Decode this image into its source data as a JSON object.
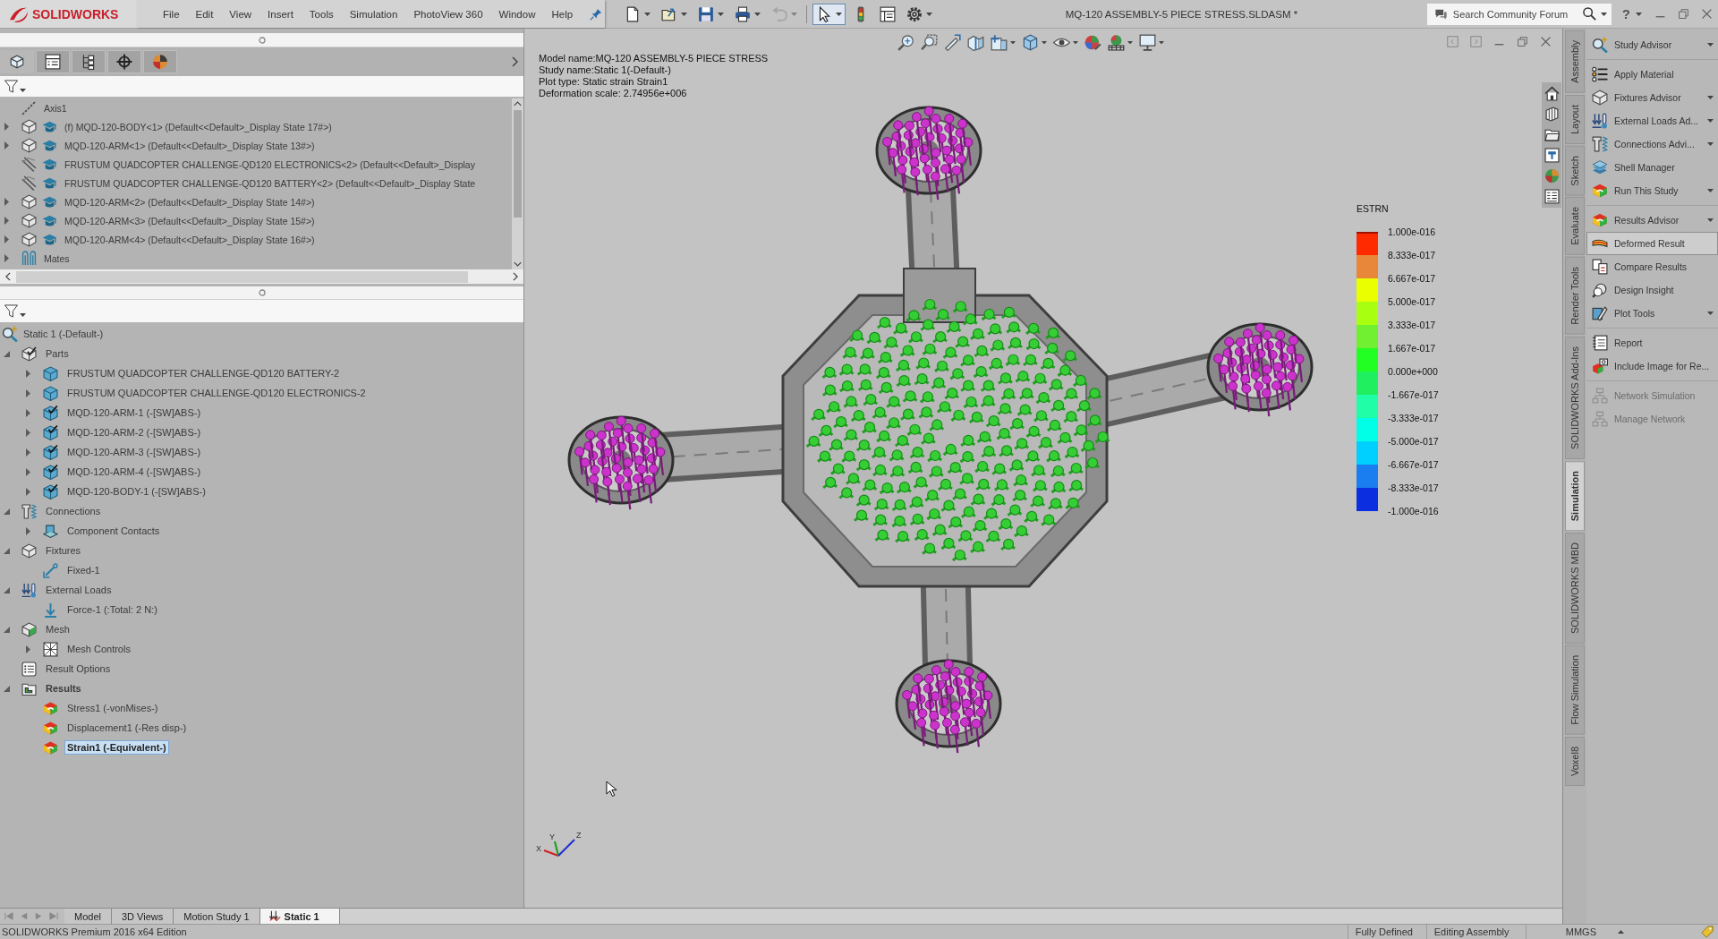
{
  "title_bar": {
    "app_name": "SOLIDWORKS",
    "menus": [
      "File",
      "Edit",
      "View",
      "Insert",
      "Tools",
      "Simulation",
      "PhotoView 360",
      "Window",
      "Help"
    ],
    "toolbar": [
      {
        "kind": "new",
        "dropdown": true,
        "disabled": false,
        "pressed": false
      },
      {
        "kind": "open",
        "dropdown": true,
        "disabled": false,
        "pressed": false
      },
      {
        "kind": "save",
        "dropdown": true,
        "disabled": false,
        "pressed": false
      },
      {
        "kind": "print",
        "dropdown": true,
        "disabled": false,
        "pressed": false
      },
      {
        "kind": "undo",
        "dropdown": true,
        "disabled": true,
        "pressed": false
      },
      {
        "kind": "separator"
      },
      {
        "kind": "select",
        "dropdown": true,
        "disabled": false,
        "pressed": true
      },
      {
        "kind": "rebuild",
        "dropdown": false,
        "disabled": false,
        "pressed": false
      },
      {
        "kind": "file-properties",
        "dropdown": false,
        "disabled": false,
        "pressed": false
      },
      {
        "kind": "options",
        "dropdown": true,
        "disabled": false,
        "pressed": false
      }
    ],
    "document_title": "MQ-120 ASSEMBLY-5 PIECE STRESS.SLDASM *",
    "search": {
      "placeholder": "Search Community Forum"
    },
    "help": "?"
  },
  "feature_manager": {
    "tabs": [
      {
        "kind": "feature-tree",
        "selected": true
      },
      {
        "kind": "property-manager",
        "selected": false
      },
      {
        "kind": "configuration-manager",
        "selected": false
      },
      {
        "kind": "dimxpert",
        "selected": false
      },
      {
        "kind": "display-manager",
        "selected": false
      }
    ],
    "tree": [
      {
        "label": "Axis1",
        "kind": "axis",
        "selected": false
      },
      {
        "label": "(f) MQD-120-BODY<1> (Default<<Default>_Display State 17#>)",
        "kind": "component",
        "expanded": false,
        "selected": false
      },
      {
        "label": "MQD-120-ARM<1> (Default<<Default>_Display State 13#>)",
        "kind": "component",
        "expanded": false,
        "selected": false
      },
      {
        "label": "FRUSTUM QUADCOPTER CHALLENGE-QD120 ELECTRONICS<2> (Default<<Default>_Display",
        "kind": "excluded-component",
        "selected": false
      },
      {
        "label": "FRUSTUM QUADCOPTER CHALLENGE-QD120 BATTERY<2> (Default<<Default>_Display State",
        "kind": "excluded-component",
        "selected": false
      },
      {
        "label": "MQD-120-ARM<2> (Default<<Default>_Display State 14#>)",
        "kind": "component",
        "expanded": false,
        "selected": false
      },
      {
        "label": "MQD-120-ARM<3> (Default<<Default>_Display State 15#>)",
        "kind": "component",
        "expanded": false,
        "selected": false
      },
      {
        "label": "MQD-120-ARM<4> (Default<<Default>_Display State 16#>)",
        "kind": "component",
        "expanded": false,
        "selected": false
      },
      {
        "label": "Mates",
        "kind": "mates",
        "expanded": false,
        "selected": false
      }
    ]
  },
  "study_tree": [
    {
      "label": "Static 1 (-Default-)",
      "kind": "study",
      "selected": false,
      "children": [
        {
          "label": "Parts",
          "kind": "parts",
          "expanded": true,
          "selected": false,
          "children": [
            {
              "label": "FRUSTUM QUADCOPTER CHALLENGE-QD120 BATTERY-2",
              "kind": "part",
              "expanded": false,
              "selected": false
            },
            {
              "label": "FRUSTUM QUADCOPTER CHALLENGE-QD120 ELECTRONICS-2",
              "kind": "part",
              "expanded": false,
              "selected": false
            },
            {
              "label": "MQD-120-ARM-1 (-[SW]ABS-)",
              "kind": "part-checked",
              "expanded": false,
              "selected": false
            },
            {
              "label": "MQD-120-ARM-2 (-[SW]ABS-)",
              "kind": "part-checked",
              "expanded": false,
              "selected": false
            },
            {
              "label": "MQD-120-ARM-3 (-[SW]ABS-)",
              "kind": "part-checked",
              "expanded": false,
              "selected": false
            },
            {
              "label": "MQD-120-ARM-4 (-[SW]ABS-)",
              "kind": "part-checked",
              "expanded": false,
              "selected": false
            },
            {
              "label": "MQD-120-BODY-1 (-[SW]ABS-)",
              "kind": "part-checked",
              "expanded": false,
              "selected": false
            }
          ]
        },
        {
          "label": "Connections",
          "kind": "connections",
          "expanded": true,
          "selected": false,
          "children": [
            {
              "label": "Component Contacts",
              "kind": "contacts",
              "expanded": false,
              "selected": false
            }
          ]
        },
        {
          "label": "Fixtures",
          "kind": "fixtures",
          "expanded": true,
          "selected": false,
          "children": [
            {
              "label": "Fixed-1",
              "kind": "fixed",
              "selected": false
            }
          ]
        },
        {
          "label": "External Loads",
          "kind": "external-loads",
          "expanded": true,
          "selected": false,
          "children": [
            {
              "label": "Force-1 (:Total: 2 N:)",
              "kind": "force",
              "selected": false
            }
          ]
        },
        {
          "label": "Mesh",
          "kind": "mesh",
          "expanded": true,
          "selected": false,
          "children": [
            {
              "label": "Mesh Controls",
              "kind": "mesh-controls",
              "expanded": false,
              "selected": false
            }
          ]
        },
        {
          "label": "Result Options",
          "kind": "result-options",
          "selected": false
        },
        {
          "label": "Results",
          "kind": "results",
          "expanded": true,
          "selected": false,
          "children": [
            {
              "label": "Stress1 (-vonMises-)",
              "kind": "plot",
              "selected": false
            },
            {
              "label": "Displacement1 (-Res disp-)",
              "kind": "plot",
              "selected": false
            },
            {
              "label": "Strain1 (-Equivalent-)",
              "kind": "plot",
              "selected": true
            }
          ]
        }
      ]
    }
  ],
  "viewport": {
    "view_toolbar": [
      {
        "kind": "zoom-fit",
        "dropdown": false
      },
      {
        "kind": "zoom-area",
        "dropdown": false
      },
      {
        "kind": "previous-view",
        "dropdown": false
      },
      {
        "kind": "section-view",
        "dropdown": false
      },
      {
        "kind": "dynamic-annotation",
        "dropdown": true
      },
      {
        "kind": "view-orientation",
        "dropdown": true
      },
      {
        "kind": "hide-show",
        "dropdown": true
      },
      {
        "kind": "edit-appearance",
        "dropdown": false
      },
      {
        "kind": "apply-scene",
        "dropdown": true
      },
      {
        "kind": "view-settings",
        "dropdown": true
      }
    ],
    "info": [
      "Model name:MQ-120 ASSEMBLY-5 PIECE STRESS",
      "Study name:Static 1(-Default-)",
      "Plot type: Static strain Strain1",
      "Deformation scale: 2.74956e+006"
    ],
    "legend": {
      "title": "ESTRN",
      "labels": [
        "1.000e-016",
        "8.333e-017",
        "6.667e-017",
        "5.000e-017",
        "3.333e-017",
        "1.667e-017",
        "0.000e+000",
        "-1.667e-017",
        "-3.333e-017",
        "-5.000e-017",
        "-6.667e-017",
        "-8.333e-017",
        "-1.000e-016"
      ]
    },
    "triad_labels": [
      "X",
      "Y",
      "Z"
    ]
  },
  "command_tabs": [
    {
      "label": "Assembly",
      "selected": false
    },
    {
      "label": "Layout",
      "selected": false
    },
    {
      "label": "Sketch",
      "selected": false
    },
    {
      "label": "Evaluate",
      "selected": false
    },
    {
      "label": "Render Tools",
      "selected": false
    },
    {
      "label": "SOLIDWORKS Add-Ins",
      "selected": false
    },
    {
      "label": "Simulation",
      "selected": true
    },
    {
      "label": "SOLIDWORKS MBD",
      "selected": false
    },
    {
      "label": "Flow Simulation",
      "selected": false
    },
    {
      "label": "Voxel8",
      "selected": false
    }
  ],
  "task_pane": {
    "groups": [
      [
        {
          "label": "Study Advisor",
          "kind": "study-advisor",
          "dropdown": true,
          "disabled": false,
          "selected": false
        }
      ],
      [
        {
          "label": "Apply Material",
          "kind": "apply-material",
          "dropdown": false,
          "disabled": false,
          "selected": false
        },
        {
          "label": "Fixtures Advisor",
          "kind": "fixtures-advisor",
          "dropdown": true,
          "disabled": false,
          "selected": false
        },
        {
          "label": "External Loads Ad...",
          "kind": "external-loads",
          "dropdown": true,
          "disabled": false,
          "selected": false
        },
        {
          "label": "Connections Advi...",
          "kind": "connections",
          "dropdown": true,
          "disabled": false,
          "selected": false
        },
        {
          "label": "Shell Manager",
          "kind": "shell-manager",
          "dropdown": false,
          "disabled": false,
          "selected": false
        },
        {
          "label": "Run This Study",
          "kind": "run-study",
          "dropdown": true,
          "disabled": false,
          "selected": false
        }
      ],
      [
        {
          "label": "Results Advisor",
          "kind": "results-advisor",
          "dropdown": true,
          "disabled": false,
          "selected": false
        },
        {
          "label": "Deformed Result",
          "kind": "deformed-result",
          "dropdown": false,
          "disabled": false,
          "selected": true
        },
        {
          "label": "Compare Results",
          "kind": "compare-results",
          "dropdown": false,
          "disabled": false,
          "selected": false
        },
        {
          "label": "Design Insight",
          "kind": "design-insight",
          "dropdown": false,
          "disabled": false,
          "selected": false
        },
        {
          "label": "Plot Tools",
          "kind": "plot-tools",
          "dropdown": true,
          "disabled": false,
          "selected": false
        }
      ],
      [
        {
          "label": "Report",
          "kind": "report",
          "dropdown": false,
          "disabled": false,
          "selected": false
        },
        {
          "label": "Include Image for Re...",
          "kind": "include-image",
          "dropdown": false,
          "disabled": false,
          "selected": false
        }
      ],
      [
        {
          "label": "Network Simulation",
          "kind": "network",
          "dropdown": false,
          "disabled": true,
          "selected": false
        },
        {
          "label": "Manage Network",
          "kind": "network",
          "dropdown": false,
          "disabled": true,
          "selected": false
        }
      ]
    ]
  },
  "bottom_tabs": [
    {
      "label": "Model",
      "kind": "model",
      "selected": false
    },
    {
      "label": "3D Views",
      "kind": "views",
      "selected": false
    },
    {
      "label": "Motion Study 1",
      "kind": "motion",
      "selected": false
    },
    {
      "label": "Static 1",
      "kind": "study",
      "selected": true
    }
  ],
  "status_bar": {
    "edition": "SOLIDWORKS Premium 2016 x64 Edition",
    "sketch_state": "Fully Defined",
    "mode": "Editing Assembly",
    "units": "MMGS"
  }
}
